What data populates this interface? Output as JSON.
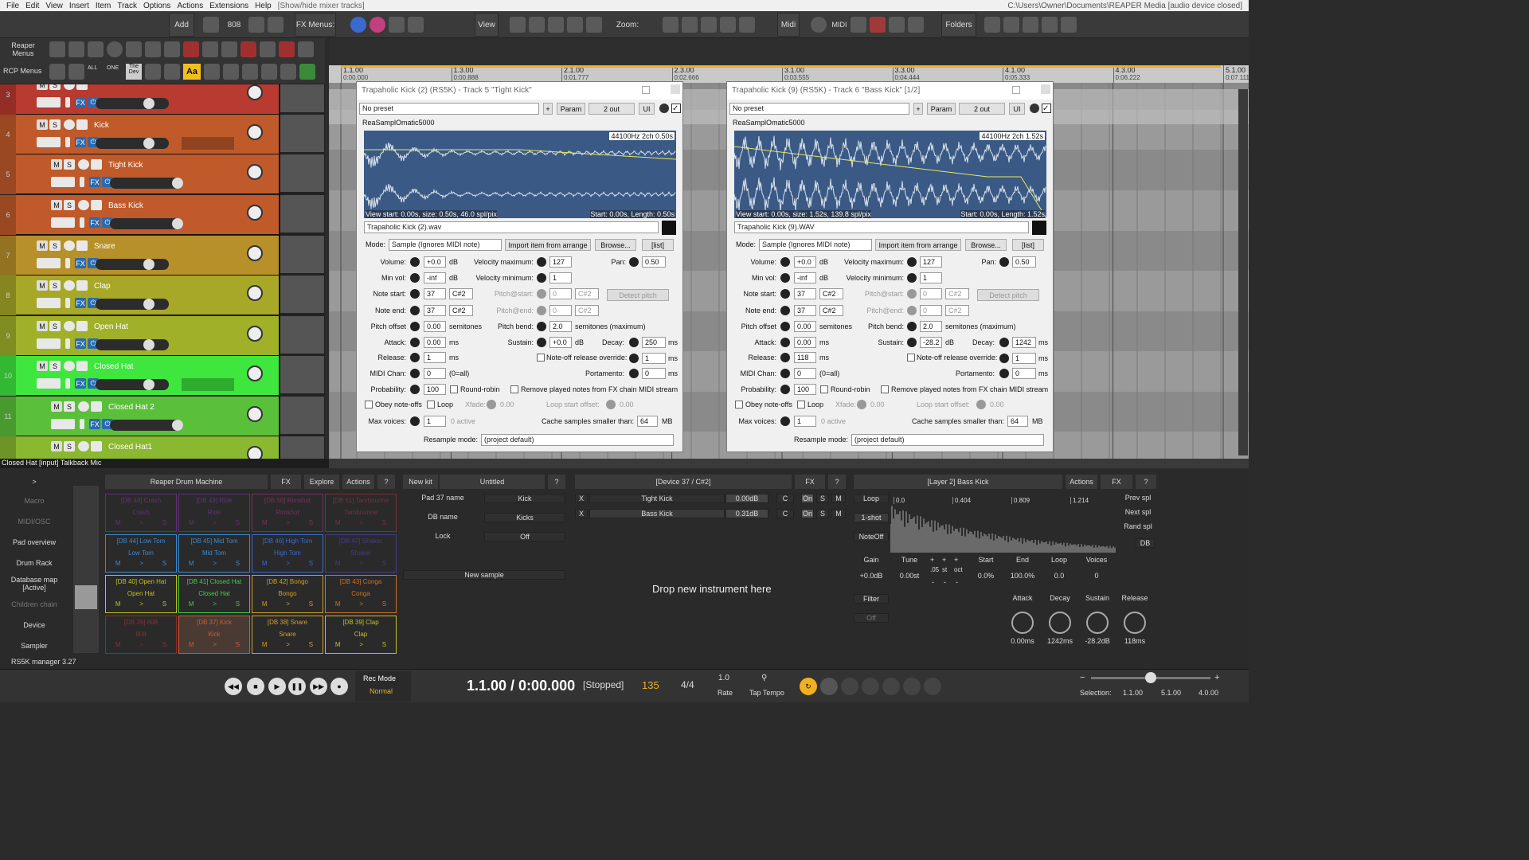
{
  "menu": {
    "items": [
      "File",
      "Edit",
      "View",
      "Insert",
      "Item",
      "Track",
      "Options",
      "Actions",
      "Extensions",
      "Help",
      "[Show/hide mixer tracks]"
    ],
    "path": "C:\\Users\\Owner\\Documents\\REAPER Media [audio device closed]"
  },
  "toolbar": {
    "add": "Add",
    "n808": "808",
    "fx_menus": "FX Menus:",
    "view": "View",
    "zoom": "Zoom:",
    "midi": "Midi",
    "midi_label": "MIDI",
    "folders": "Folders"
  },
  "rcp": {
    "reaper_menus": "Reaper Menus",
    "rcp_menus": "RCP Menus",
    "all": "ALL",
    "one": "ONE",
    "the_dev": "The Dev",
    "aa": "Aa"
  },
  "tracks": [
    {
      "num": "3",
      "name": "",
      "color": "#b83a30"
    },
    {
      "num": "4",
      "name": "Kick",
      "color": "#c05a2a"
    },
    {
      "num": "5",
      "name": "Tight Kick",
      "color": "#c05a2a"
    },
    {
      "num": "6",
      "name": "Bass Kick",
      "color": "#c05a2a"
    },
    {
      "num": "7",
      "name": "Snare",
      "color": "#b8902a"
    },
    {
      "num": "8",
      "name": "Clap",
      "color": "#a8a828"
    },
    {
      "num": "9",
      "name": "Open Hat",
      "color": "#a0b028"
    },
    {
      "num": "10",
      "name": "Closed Hat",
      "color": "#3ee63e"
    },
    {
      "num": "11",
      "name": "Closed Hat 2",
      "color": "#5ac03a"
    },
    {
      "num": "",
      "name": "Closed Hat1",
      "color": "#8ab830"
    }
  ],
  "track_btn": {
    "m": "M",
    "s": "S",
    "fx": "FX"
  },
  "ruler": {
    "marks": [
      "1.1.00",
      "1.3.00",
      "2.1.00",
      "2.3.00",
      "3.1.00",
      "3.3.00",
      "4.1.00",
      "4.3.00",
      "5.1.00"
    ],
    "times": [
      "0:00.000",
      "0:00.888",
      "0:01.777",
      "0:02.666",
      "0:03.555",
      "0:04.444",
      "0:05.333",
      "0:06.222",
      "0:07.111"
    ]
  },
  "fx1": {
    "title": "Trapaholic Kick (2) (RS5K) - Track 5 \"Tight Kick\"",
    "preset": "No preset",
    "plus": "+",
    "param": "Param",
    "out": "2 out",
    "ui": "UI",
    "plugin": "ReaSamplOmatic5000",
    "wave_info": "44100Hz 2ch 0.50s",
    "view_start": "View start: 0.00s, size: 0.50s, 46.0 spl/pix",
    "start": "Start: 0.00s, Length: 0.50s",
    "file": "Trapaholic Kick (2).wav",
    "mode_label": "Mode:",
    "mode": "Sample (Ignores MIDI note)",
    "import": "Import item from arrange",
    "browse": "Browse...",
    "list": "[list]",
    "volume": "+0.0",
    "minvol": "-inf",
    "note_start": "37",
    "note_start_n": "C#2",
    "note_end": "37",
    "note_end_n": "C#2",
    "pitch_offset": "0.00",
    "attack": "0.00",
    "release": "1",
    "midi_chan": "0",
    "probability": "100",
    "max_voices": "1",
    "vel_max": "127",
    "vel_min": "1",
    "pitch_start": "0",
    "pitch_start_n": "C#2",
    "pitch_end": "0",
    "pitch_end_n": "C#2",
    "pitch_bend": "2.0",
    "sustain": "+0.0",
    "pan": "0.50",
    "decay": "250",
    "noteoff_override": "1",
    "portamento": "0",
    "xfade": "0.00",
    "loop_offset": "0.00",
    "cache": "64",
    "resample": "(project default)"
  },
  "fx2": {
    "title": "Trapaholic Kick (9) (RS5K) - Track 6 \"Bass Kick\" [1/2]",
    "preset": "No preset",
    "plus": "+",
    "param": "Param",
    "out": "2 out",
    "ui": "UI",
    "plugin": "ReaSamplOmatic5000",
    "wave_info": "44100Hz 2ch 1.52s",
    "view_start": "View start: 0.00s, size: 1.52s, 139.8 spl/pix",
    "start": "Start: 0.00s, Length: 1.52s",
    "file": "Trapaholic Kick (9).WAV",
    "mode_label": "Mode:",
    "mode": "Sample (Ignores MIDI note)",
    "import": "Import item from arrange",
    "browse": "Browse...",
    "list": "[list]",
    "volume": "+0.0",
    "minvol": "-inf",
    "note_start": "37",
    "note_start_n": "C#2",
    "note_end": "37",
    "note_end_n": "C#2",
    "pitch_offset": "0.00",
    "attack": "0.00",
    "release": "118",
    "midi_chan": "0",
    "probability": "100",
    "max_voices": "1",
    "vel_max": "127",
    "vel_min": "1",
    "pitch_start": "0",
    "pitch_start_n": "C#2",
    "pitch_end": "0",
    "pitch_end_n": "C#2",
    "pitch_bend": "2.0",
    "sustain": "-28.2",
    "pan": "0.50",
    "decay": "1242",
    "noteoff_override": "1",
    "portamento": "0",
    "xfade": "0.00",
    "loop_offset": "0.00",
    "cache": "64",
    "resample": "(project default)"
  },
  "labels": {
    "volume": "Volume:",
    "minvol": "Min vol:",
    "note_start": "Note start:",
    "note_end": "Note end:",
    "pitch_offset": "Pitch offset",
    "attack": "Attack:",
    "release": "Release:",
    "midi_chan": "MIDI Chan:",
    "probability": "Probability:",
    "obey": "Obey note-offs",
    "max_voices": "Max voices:",
    "vel_max": "Velocity maximum:",
    "vel_min": "Velocity minimum:",
    "pitch_start": "Pitch@start:",
    "pitch_end": "Pitch@end:",
    "pitch_bend": "Pitch bend:",
    "sustain": "Sustain:",
    "noteoff": "Note-off release override:",
    "roundrobin": "Round-robin",
    "loop": "Loop",
    "xfade": "Xfade:",
    "loop_start": "Loop start offset:",
    "active": "0 active",
    "cache": "Cache samples smaller than:",
    "resample": "Resample mode:",
    "pan": "Pan:",
    "decay": "Decay:",
    "portamento": "Portamento:",
    "detect": "Detect pitch",
    "remove": "Remove played notes from FX chain MIDI stream",
    "db": "dB",
    "ms": "ms",
    "semitones": "semitones",
    "semitones_max": "semitones (maximum)",
    "all": "(0=all)",
    "mb": "MB"
  },
  "status": "Closed Hat [input] Talkback Mic",
  "drum": {
    "nav": [
      "Macro",
      "MIDI/OSC",
      "Pad overview",
      "Drum Rack",
      "Database map [Active]",
      "Children chain",
      "Device",
      "Sampler"
    ],
    "arrow": ">",
    "title": "Reaper Drum Machine",
    "fx": "FX",
    "explore": "Explore",
    "actions": "Actions",
    "q": "?",
    "footer": "RS5K manager 3.27",
    "pads": [
      {
        "top": "[DB 48] Crash",
        "name": "Crash",
        "color": "#8a3ab0"
      },
      {
        "top": "[DB 49] Ride",
        "name": "Ride",
        "color": "#8a3ab0"
      },
      {
        "top": "[DB 50] Rimshot",
        "name": "Rimshot",
        "color": "#b03a80"
      },
      {
        "top": "[DB 51] Tambourine",
        "name": "Tambourine",
        "color": "#b03a50"
      },
      {
        "top": "[DB 44] Low Tom",
        "name": "Low Tom",
        "color": "#3a8ad0"
      },
      {
        "top": "[DB 45] Mid Tom",
        "name": "Mid Tom",
        "color": "#3a8ad0"
      },
      {
        "top": "[DB 46] High Tom",
        "name": "High Tom",
        "color": "#3a6ad0"
      },
      {
        "top": "[DB 47] Shaker",
        "name": "Shaker",
        "color": "#5a4ad0"
      },
      {
        "top": "[DB 40] Open Hat",
        "name": "Open Hat",
        "color": "#c0c020"
      },
      {
        "top": "[DB 41] Closed Hat",
        "name": "Closed Hat",
        "color": "#40d040"
      },
      {
        "top": "[DB 42] Bongo",
        "name": "Bongo",
        "color": "#d0a020"
      },
      {
        "top": "[DB 43] Conga",
        "name": "Conga",
        "color": "#d07020"
      },
      {
        "top": "[DB 36] 808",
        "name": "808",
        "color": "#d03a30"
      },
      {
        "top": "[DB 37] Kick",
        "name": "Kick",
        "color": "#d05a30"
      },
      {
        "top": "[DB 38] Snare",
        "name": "Snare",
        "color": "#d0a030"
      },
      {
        "top": "[DB 39] Clap",
        "name": "Clap",
        "color": "#c0c030"
      }
    ],
    "pad_btns": [
      "M",
      ">",
      "S"
    ]
  },
  "kit": {
    "new_kit": "New kit",
    "untitled": "Untitled",
    "q": "?",
    "pad_label": "Pad 37 name",
    "pad_value": "Kick",
    "db_label": "DB name",
    "db_value": "Kicks",
    "lock_label": "Lock",
    "lock_value": "Off",
    "new_sample": "New sample"
  },
  "device": {
    "title": "[Device 37 / C#2]",
    "fx": "FX",
    "q": "?",
    "rows": [
      {
        "x": "X",
        "name": "Tight Kick",
        "db": "0.00dB",
        "c": "C",
        "on": "On",
        "s": "S",
        "m": "M"
      },
      {
        "x": "X",
        "name": "Bass Kick",
        "db": "0.31dB",
        "c": "C",
        "on": "On",
        "s": "S",
        "m": "M"
      }
    ],
    "drop": "Drop new instrument here"
  },
  "layer": {
    "title": "[Layer 2] Bass Kick",
    "actions": "Actions",
    "fx": "FX",
    "q": "?",
    "loop": "Loop",
    "oneshot": "1-shot",
    "noteoff": "NoteOff",
    "ticks": [
      "0.0",
      "0.404",
      "0.809",
      "1.214"
    ],
    "prev": "Prev spl",
    "next": "Next spl",
    "rand": "Rand spl",
    "db": "DB",
    "gain_l": "Gain",
    "gain": "+0.0dB",
    "tune_l": "Tune",
    "tune": "0.00st",
    "offs": [
      ".05",
      "st",
      "oct"
    ],
    "start_l": "Start",
    "start": "0.0%",
    "end_l": "End",
    "end": "100.0%",
    "loopl_l": "Loop",
    "loopl": "0.0",
    "voices_l": "Voices",
    "voices": "0",
    "filter": "Filter",
    "off": "Off",
    "attack_l": "Attack",
    "attack": "0.00ms",
    "decay_l": "Decay",
    "decay": "1242ms",
    "sustain_l": "Sustain",
    "sustain": "-28.2dB",
    "release_l": "Release",
    "release": "118ms"
  },
  "transport": {
    "recmode": "Rec Mode",
    "normal": "Normal",
    "position": "1.1.00 / 0:00.000",
    "state": "[Stopped]",
    "bpm": "135",
    "sig": "4/4",
    "rate_val": "1.0",
    "rate": "Rate",
    "tap": "Tap Tempo",
    "sel_label": "Selection:",
    "sel": [
      "1.1.00",
      "5.1.00",
      "4.0.00"
    ],
    "minus": "−",
    "plus": "+"
  }
}
